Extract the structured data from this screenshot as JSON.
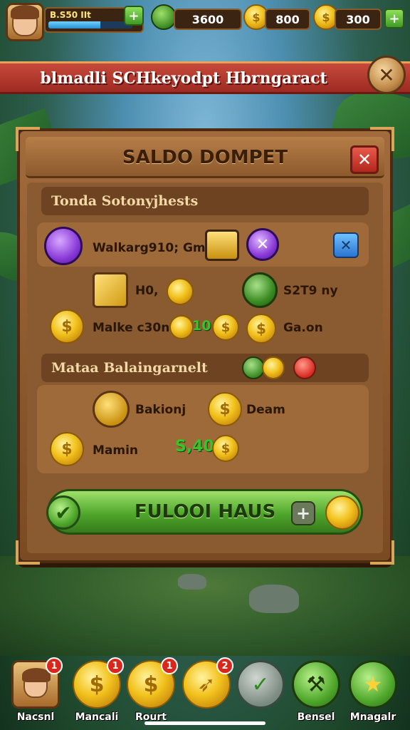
{
  "hud": {
    "level_label": "B.S50 IIt",
    "xp_progress_pct": 62,
    "res1_value": "3600",
    "res2_value": "800",
    "res3_value": "300",
    "add_symbol": "+"
  },
  "banner": {
    "title": "blmadli SCHkeyodpt Hbrngaract",
    "close_symbol": "✕"
  },
  "panel": {
    "title": "SALDO DOMPET",
    "close_symbol": "✕",
    "section1_title": "Tonda Sotonyjhests",
    "row1": {
      "label": "Walkarg910; Gm"
    },
    "row2": {
      "label": "H0,",
      "right_label": "S2T9 ny"
    },
    "row3": {
      "label": "Malke c30n",
      "green_value": "10",
      "right_label": "Ga.on"
    },
    "section2_title": "Mataa Balaingarnelt",
    "row4": {
      "label": "Bakionj",
      "right_label": "Deam"
    },
    "row5": {
      "label": "Mamin",
      "green_value": "S,40"
    },
    "cta_label": "FULOOI HAUS",
    "cta_plus": "+"
  },
  "coin_glyph": "$",
  "nav": [
    {
      "label": "Nacsnl",
      "badge": "1",
      "icon": "avatar-icon"
    },
    {
      "label": "Mancali",
      "badge": "1",
      "icon": "coin-icon"
    },
    {
      "label": "Rourt",
      "badge": "1",
      "icon": "coin-icon"
    },
    {
      "label": "",
      "badge": "2",
      "icon": "rocket-coin-icon"
    },
    {
      "label": "",
      "badge": "",
      "icon": "check-icon"
    },
    {
      "label": "Bensel",
      "badge": "",
      "icon": "build-icon"
    },
    {
      "label": "Mnagalr",
      "badge": "",
      "icon": "star-icon"
    }
  ],
  "colors": {
    "accent_green": "#4fa72b",
    "banner_red": "#b2261c",
    "wood": "#8d5a2c",
    "gold": "#f2c21d",
    "purple": "#8a3ad8"
  }
}
